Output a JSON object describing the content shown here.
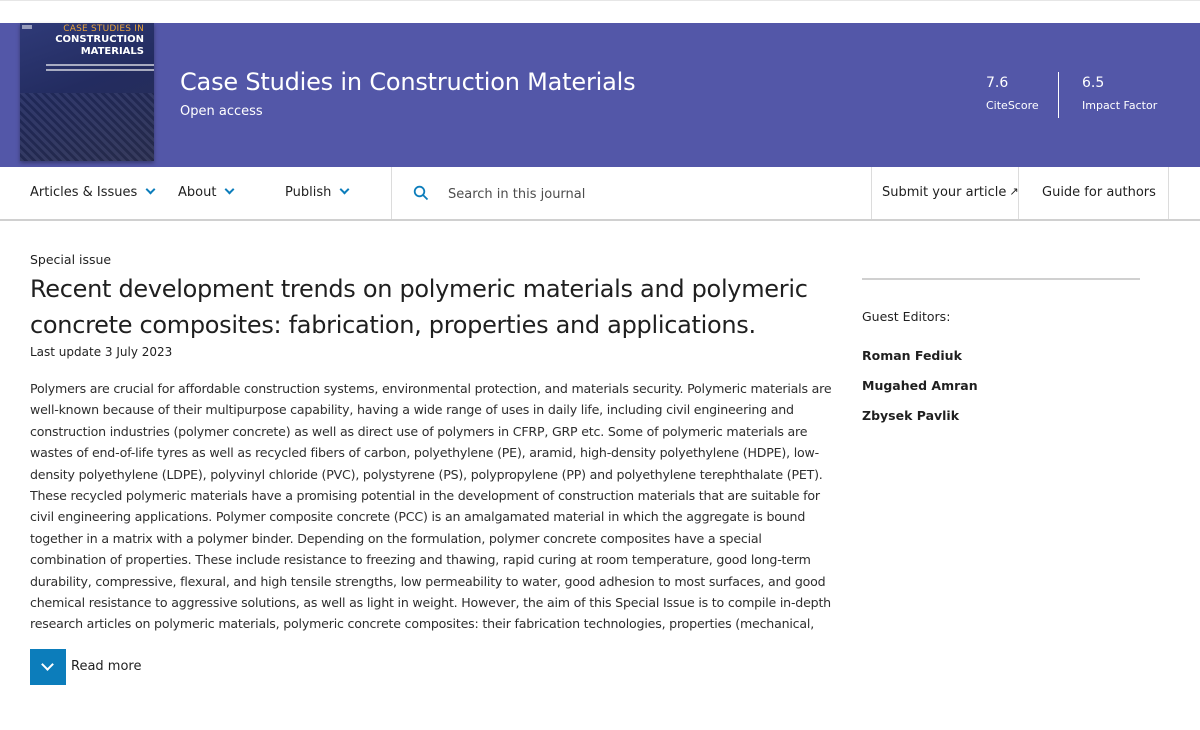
{
  "header": {
    "cover": {
      "line1": "CASE STUDIES IN",
      "line2": "CONSTRUCTION",
      "line3": "MATERIALS"
    },
    "journal_title": "Case Studies in Construction Materials",
    "access_label": "Open access",
    "metrics": [
      {
        "value": "7.6",
        "label": "CiteScore"
      },
      {
        "value": "6.5",
        "label": "Impact Factor"
      }
    ]
  },
  "nav": {
    "articles_issues": "Articles & Issues",
    "about": "About",
    "publish": "Publish",
    "search_placeholder": "Search in this journal",
    "submit": "Submit your article",
    "guide": "Guide for authors"
  },
  "main": {
    "kicker": "Special issue",
    "title": "Recent development trends on polymeric materials and polymeric concrete composites: fabrication, properties and applications.",
    "last_update": "Last update 3 July 2023",
    "abstract": "Polymers are crucial for affordable construction systems, environmental protection, and materials security. Polymeric materials are well-known because of their multipurpose capability, having a wide range of uses in daily life, including civil engineering and construction industries (polymer concrete) as well as direct use of polymers in CFRP, GRP etc. Some of polymeric materials are wastes of end-of-life tyres as well as recycled fibers of carbon, polyethylene (PE), aramid, high-density polyethylene (HDPE), low-density polyethylene (LDPE), polyvinyl chloride (PVC), polystyrene (PS), polypropylene (PP) and polyethylene terephthalate (PET). These recycled polymeric materials have a promising potential in the development of construction materials that are suitable for civil engineering applications. Polymer composite concrete (PCC) is an amalgamated material in which the aggregate is bound together in a matrix with a polymer binder. Depending on the formulation, polymer concrete composites have a special combination of properties. These include resistance to freezing and thawing, rapid curing at room temperature, good long-term durability, compressive, flexural, and high tensile strengths, low permeability to water, good adhesion to most surfaces, and good chemical resistance to aggressive solutions, as well as light in weight. However, the aim of this Special Issue is to compile in-depth research articles on polymeric materials, polymeric concrete composites: their fabrication technologies, properties (mechanical, thermal, hygric, functional, and",
    "read_more": "Read more"
  },
  "sidebar": {
    "guest_label": "Guest Editors:",
    "editors": [
      "Roman Fediuk",
      "Mugahed Amran",
      "Zbysek Pavlik"
    ]
  },
  "colors": {
    "banner": "#5357a8",
    "accent": "#0c7dbb"
  },
  "icons": {
    "nav_chevron": "chevron-down-icon",
    "search": "search-icon",
    "external": "external-link-icon",
    "read_more": "chevron-down-icon"
  }
}
